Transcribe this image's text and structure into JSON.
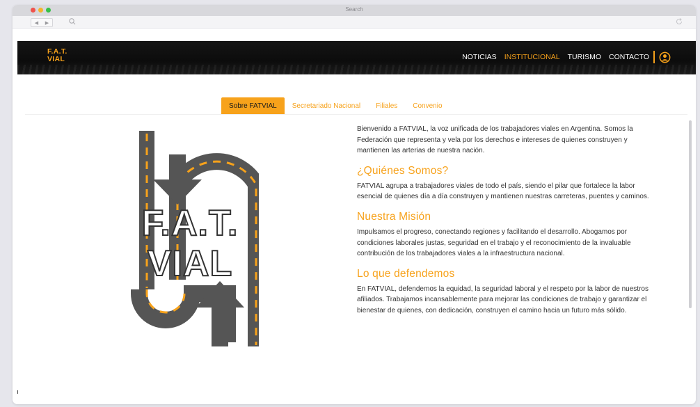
{
  "window": {
    "title": "Search"
  },
  "site": {
    "logo_line1": "F.A.T.",
    "logo_line2": "VIAL",
    "nav": [
      {
        "label": "NOTICIAS",
        "active": false
      },
      {
        "label": "INSTITUCIONAL",
        "active": true
      },
      {
        "label": "TURISMO",
        "active": false
      },
      {
        "label": "CONTACTO",
        "active": false
      }
    ],
    "accent_color": "#f7a21b",
    "header_color": "#111111"
  },
  "tabs": [
    {
      "label": "Sobre FATVIAL",
      "active": true
    },
    {
      "label": "Secretariado Nacional",
      "active": false
    },
    {
      "label": "Filiales",
      "active": false
    },
    {
      "label": "Convenio",
      "active": false
    }
  ],
  "graphic": {
    "line1": "F.A.T.",
    "line2": "VIAL"
  },
  "content": {
    "intro": "Bienvenido a FATVIAL, la voz unificada de los trabajadores viales en Argentina. Somos la Federación que representa y vela por los derechos e intereses de quienes construyen y mantienen las arterias de nuestra nación.",
    "sections": [
      {
        "heading": "¿Quiénes Somos?",
        "body": "FATVIAL agrupa a trabajadores viales de todo el país, siendo el pilar que fortalece la labor esencial de quienes día a día construyen y mantienen nuestras carreteras, puentes y caminos."
      },
      {
        "heading": "Nuestra Misión",
        "body": "Impulsamos el progreso, conectando regiones y facilitando el desarrollo. Abogamos por condiciones laborales justas, seguridad en el trabajo y el reconocimiento de la invaluable contribución de los trabajadores viales a la infraestructura nacional."
      },
      {
        "heading": "Lo que defendemos",
        "body": "En FATVIAL, defendemos la equidad, la seguridad laboral y el respeto por la labor de nuestros afiliados. Trabajamos incansablemente para mejorar las condiciones de trabajo y garantizar el bienestar de quienes, con dedicación, construyen el camino hacia un futuro más sólido."
      }
    ]
  }
}
